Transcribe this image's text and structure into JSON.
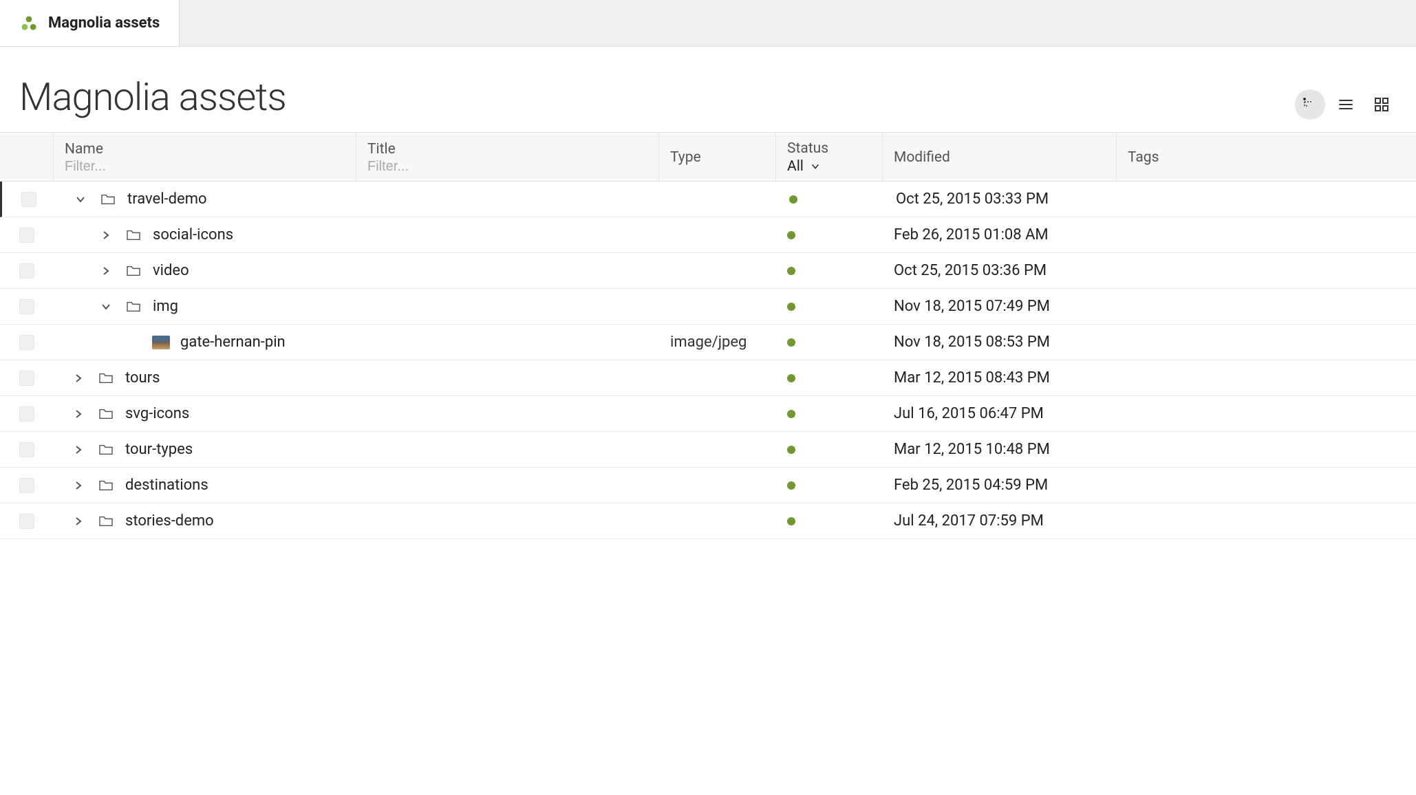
{
  "tab": {
    "label": "Magnolia assets"
  },
  "page": {
    "title": "Magnolia assets"
  },
  "columns": {
    "name": {
      "label": "Name",
      "filter_placeholder": "Filter..."
    },
    "title": {
      "label": "Title",
      "filter_placeholder": "Filter..."
    },
    "type": {
      "label": "Type"
    },
    "status": {
      "label": "Status",
      "filter_value": "All"
    },
    "modified": {
      "label": "Modified"
    },
    "tags": {
      "label": "Tags"
    }
  },
  "status_color": "#6f9a2f",
  "rows": [
    {
      "name": "travel-demo",
      "kind": "folder",
      "depth": 0,
      "expanded": true,
      "selected": true,
      "type": "",
      "status": "published",
      "modified": "Oct 25, 2015 03:33 PM",
      "tags": ""
    },
    {
      "name": "social-icons",
      "kind": "folder",
      "depth": 1,
      "expanded": false,
      "selected": false,
      "type": "",
      "status": "published",
      "modified": "Feb 26, 2015 01:08 AM",
      "tags": ""
    },
    {
      "name": "video",
      "kind": "folder",
      "depth": 1,
      "expanded": false,
      "selected": false,
      "type": "",
      "status": "published",
      "modified": "Oct 25, 2015 03:36 PM",
      "tags": ""
    },
    {
      "name": "img",
      "kind": "folder",
      "depth": 1,
      "expanded": true,
      "selected": false,
      "type": "",
      "status": "published",
      "modified": "Nov 18, 2015 07:49 PM",
      "tags": ""
    },
    {
      "name": "gate-hernan-pin",
      "kind": "image",
      "depth": 2,
      "expanded": null,
      "selected": false,
      "type": "image/jpeg",
      "status": "published",
      "modified": "Nov 18, 2015 08:53 PM",
      "tags": ""
    },
    {
      "name": "tours",
      "kind": "folder",
      "depth": 0,
      "expanded": false,
      "selected": false,
      "type": "",
      "status": "published",
      "modified": "Mar 12, 2015 08:43 PM",
      "tags": ""
    },
    {
      "name": "svg-icons",
      "kind": "folder",
      "depth": 0,
      "expanded": false,
      "selected": false,
      "type": "",
      "status": "published",
      "modified": "Jul 16, 2015 06:47 PM",
      "tags": ""
    },
    {
      "name": "tour-types",
      "kind": "folder",
      "depth": 0,
      "expanded": false,
      "selected": false,
      "type": "",
      "status": "published",
      "modified": "Mar 12, 2015 10:48 PM",
      "tags": ""
    },
    {
      "name": "destinations",
      "kind": "folder",
      "depth": 0,
      "expanded": false,
      "selected": false,
      "type": "",
      "status": "published",
      "modified": "Feb 25, 2015 04:59 PM",
      "tags": ""
    },
    {
      "name": "stories-demo",
      "kind": "folder",
      "depth": 0,
      "expanded": false,
      "selected": false,
      "type": "",
      "status": "published",
      "modified": "Jul 24, 2017 07:59 PM",
      "tags": ""
    }
  ],
  "view_modes": {
    "tree": "tree",
    "list": "list",
    "grid": "grid",
    "active": "tree"
  }
}
